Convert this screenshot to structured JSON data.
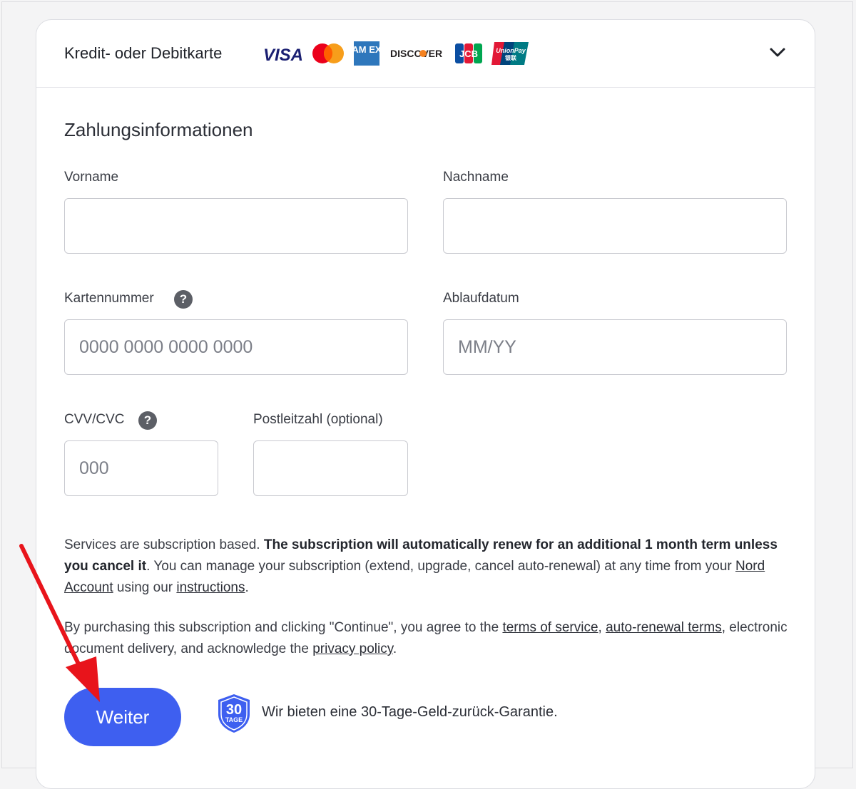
{
  "header": {
    "title": "Kredit- oder Debitkarte",
    "logos": {
      "visa": "VISA",
      "amex": "AM EX",
      "discover": "DISCOVER",
      "jcb": "JCB",
      "unionpay": "UnionPay",
      "unionpay_sub": "银联"
    },
    "expand_icon": "chevron-down-icon"
  },
  "form": {
    "title": "Zahlungsinformationen",
    "first_name": {
      "label": "Vorname",
      "value": "",
      "placeholder": ""
    },
    "last_name": {
      "label": "Nachname",
      "value": "",
      "placeholder": ""
    },
    "card_number": {
      "label": "Kartennummer",
      "placeholder": "0000 0000 0000 0000",
      "help": "?"
    },
    "expiry": {
      "label": "Ablaufdatum",
      "placeholder": "MM/YY"
    },
    "cvv": {
      "label": "CVV/CVC",
      "placeholder": "000",
      "help": "?"
    },
    "zip": {
      "label": "Postleitzahl (optional)",
      "placeholder": ""
    }
  },
  "legal": {
    "p1_a": "Services are subscription based. ",
    "p1_bold": "The subscription will automatically renew for an additional 1 month term unless you cancel it",
    "p1_b": ". You can manage your subscription (extend, upgrade, cancel auto-renewal) at any time from your ",
    "link_account": "Nord Account",
    "p1_c": " using our ",
    "link_instructions": "instructions",
    "p1_d": ".",
    "p2_a": "By purchasing this subscription and clicking \"Continue\", you agree to the ",
    "link_terms": "terms of service",
    "p2_b": ", ",
    "link_autorenewal": "auto-renewal terms",
    "p2_c": ", electronic document delivery, and acknowledge the ",
    "link_privacy": "privacy policy",
    "p2_d": "."
  },
  "footer": {
    "button_label": "Weiter",
    "badge_number": "30",
    "badge_text": "TAGE",
    "guarantee": "Wir bieten eine 30-Tage-Geld-zurück-Garantie."
  },
  "colors": {
    "accent": "#3e5ff0",
    "arrow": "#e8141b",
    "badge": "#3e5ff0"
  }
}
